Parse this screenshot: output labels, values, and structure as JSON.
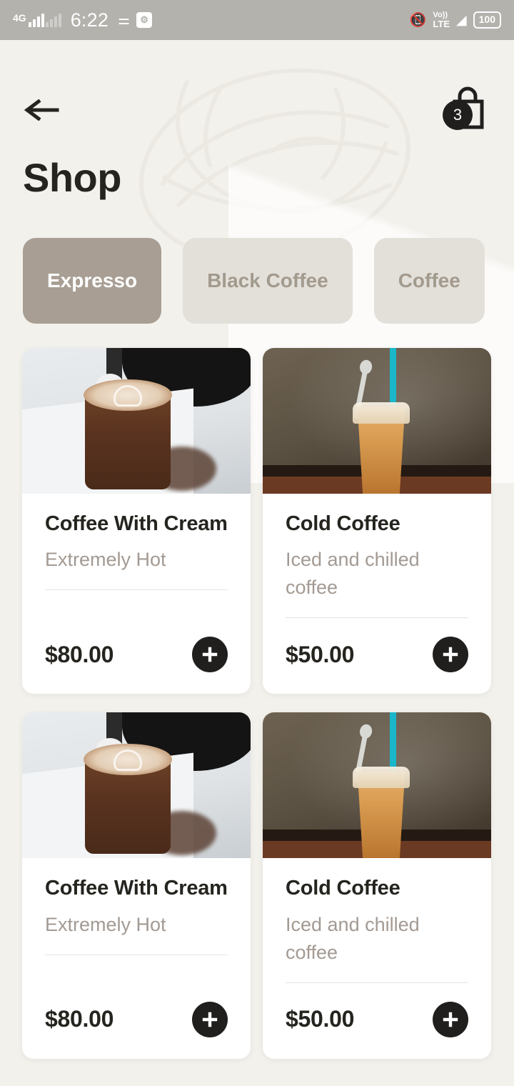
{
  "status_bar": {
    "network_type": "4G",
    "time": "6:22",
    "usb_icon": "usb-icon",
    "debug_icon": "adb-debug-icon",
    "vibrate_icon": "vibrate-icon",
    "volte_top": "Vo))",
    "volte_bottom": "LTE",
    "sim_index": "1",
    "wifi_icon": "wifi-icon",
    "battery": "100"
  },
  "header": {
    "back_icon": "back-arrow-icon",
    "bag_icon": "shopping-bag-icon",
    "cart_count": "3",
    "title": "Shop"
  },
  "categories": {
    "items": [
      {
        "label": "Expresso",
        "active": true
      },
      {
        "label": "Black Coffee",
        "active": false
      },
      {
        "label": "Coffee",
        "active": false
      }
    ]
  },
  "products": {
    "add_icon": "plus-icon",
    "items": [
      {
        "name": "Coffee With Cream",
        "description": "Extremely Hot",
        "price": "$80.00",
        "image": "hot-coffee-latte-art-photo"
      },
      {
        "name": "Cold Coffee",
        "description": "Iced and chilled coffee",
        "price": "$50.00",
        "image": "iced-coffee-with-straw-photo"
      },
      {
        "name": "Coffee With Cream",
        "description": "Extremely Hot",
        "price": "$80.00",
        "image": "hot-coffee-latte-art-photo"
      },
      {
        "name": "Cold Coffee",
        "description": "Iced and chilled coffee",
        "price": "$50.00",
        "image": "iced-coffee-with-straw-photo"
      }
    ]
  },
  "colors": {
    "page_background": "#f3f1ec",
    "status_bar_background": "#b4b2ad",
    "active_tab": "#a89e93",
    "inactive_tab": "#e3e0da",
    "inactive_tab_text": "#a39a8e",
    "card_background": "#ffffff",
    "text_primary": "#25241f",
    "text_muted": "#a39a93",
    "accent_dark": "#201f1e"
  }
}
